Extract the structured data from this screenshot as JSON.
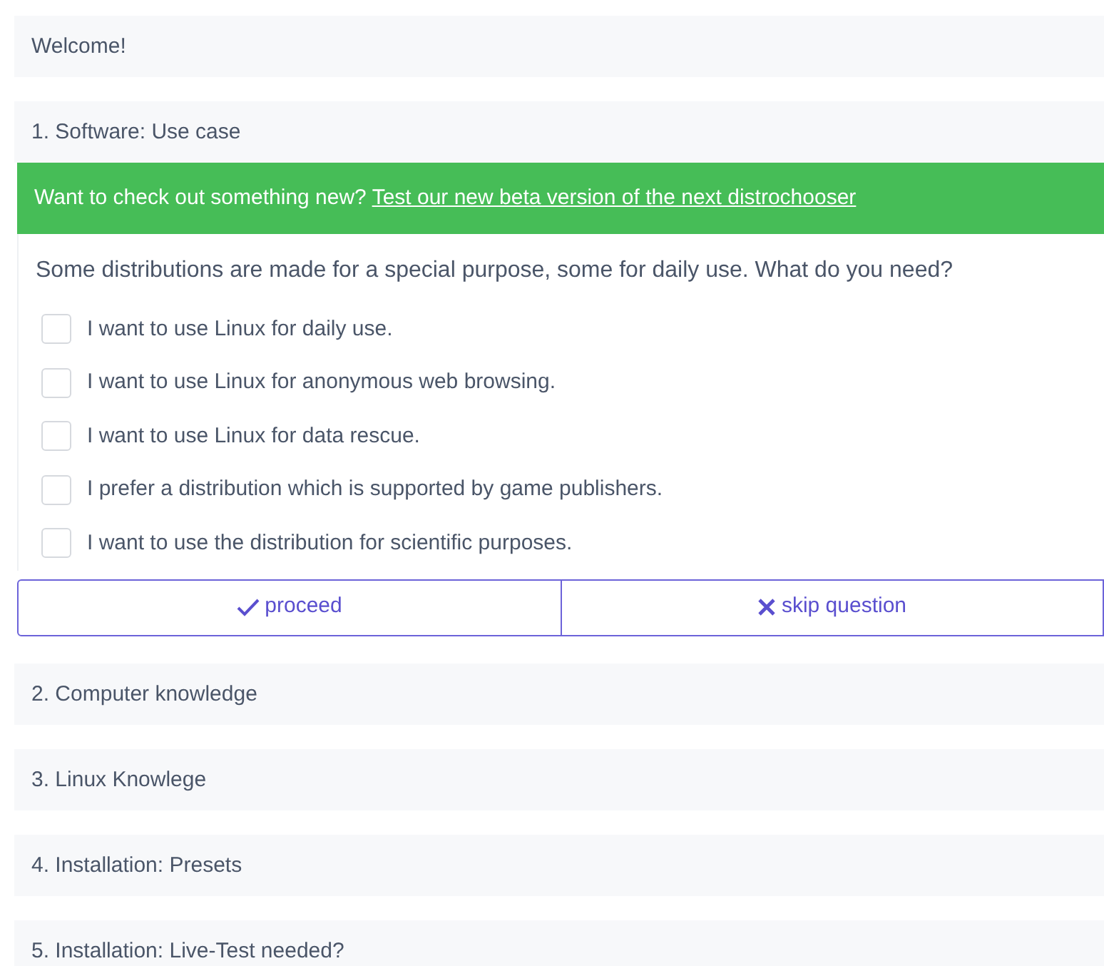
{
  "sections": [
    {
      "title": "Welcome!"
    },
    {
      "title": "1. Software: Use case",
      "banner": {
        "text": "Want to check out something new?",
        "link": "Test our new beta version of the next distrochooser"
      },
      "question": "Some distributions are made for a special purpose, some for daily use. What do you need?",
      "options": [
        {
          "label": "I want to use Linux for daily use.",
          "checked": false
        },
        {
          "label": "I want to use Linux for anonymous web browsing.",
          "checked": false
        },
        {
          "label": "I want to use Linux for data rescue.",
          "checked": false
        },
        {
          "label": "I prefer a distribution which is supported by game publishers.",
          "checked": false
        },
        {
          "label": "I want to use the distribution for scientific purposes.",
          "checked": false
        }
      ],
      "buttons": [
        {
          "kind": "proceed",
          "label": "proceed"
        },
        {
          "kind": "skip",
          "label": "skip question"
        }
      ]
    },
    {
      "title": "2. Computer knowledge"
    },
    {
      "title": "3. Linux Knowlege"
    },
    {
      "title": "4. Installation: Presets"
    },
    {
      "title": "5. Installation: Live-Test needed?"
    }
  ]
}
